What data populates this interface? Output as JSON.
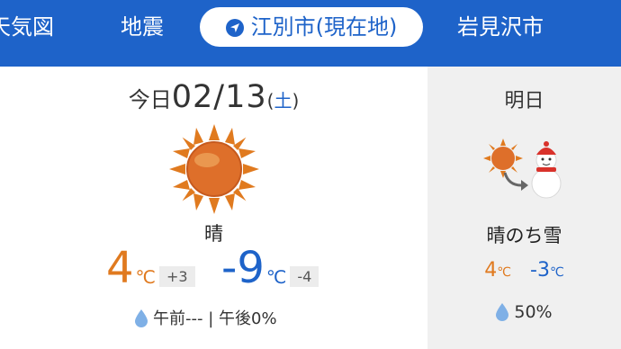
{
  "tabs": {
    "weather_map": "天気図",
    "earthquake": "地震",
    "current": "江別市(現在地)",
    "iwamizawa": "岩見沢市",
    "more": "　"
  },
  "today": {
    "prefix": "今日",
    "date": "02/13",
    "paren_open": "(",
    "dow": "土",
    "paren_close": ")",
    "condition": "晴",
    "high": "4",
    "high_unit": "℃",
    "high_diff": "+3",
    "low": "-9",
    "low_unit": "℃",
    "low_diff": "-4",
    "precip": "午前--- | 午後0%",
    "icon": "sun-icon"
  },
  "tomorrow": {
    "label": "明日",
    "condition": "晴のち雪",
    "high": "4",
    "high_unit": "℃",
    "low": "-3",
    "low_unit": "℃",
    "precip": "50%",
    "icon": "sun-then-snowman-icon"
  },
  "colors": {
    "brand": "#1e63c9",
    "high": "#e07a1f",
    "low": "#1e63c9",
    "tomorrow_bg": "#f0f0f0"
  }
}
